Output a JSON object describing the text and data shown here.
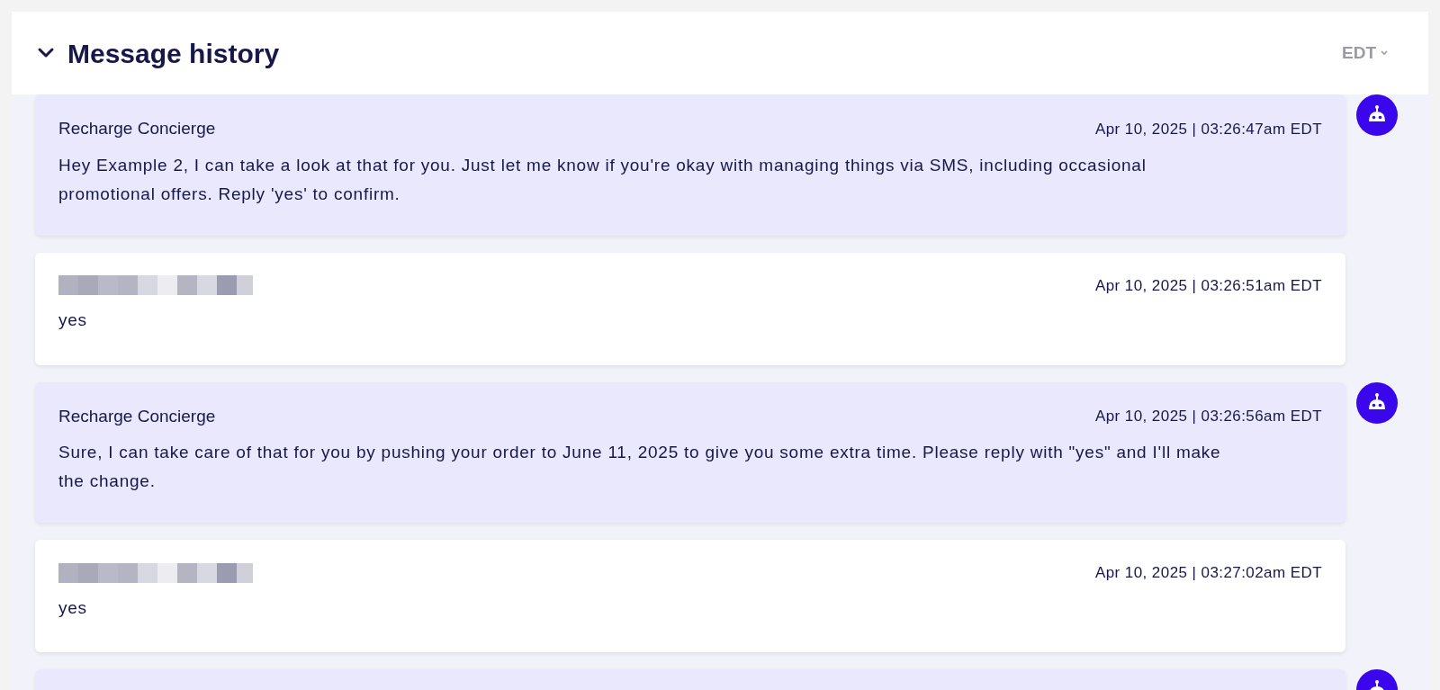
{
  "header": {
    "title": "Message history",
    "expanded": true,
    "timezone": "EDT"
  },
  "messages": [
    {
      "kind": "bot",
      "sender": "Recharge Concierge",
      "time": "Apr 10, 2025 | 03:26:47am EDT",
      "text": "Hey Example 2, I can take a look at that for you. Just let me know if you're okay with managing things via SMS, including occasional promotional offers. Reply 'yes' to confirm."
    },
    {
      "kind": "customer",
      "time": "Apr 10, 2025 | 03:26:51am EDT",
      "text": "yes"
    },
    {
      "kind": "bot",
      "sender": "Recharge Concierge",
      "time": "Apr 10, 2025 | 03:26:56am EDT",
      "text": "Sure, I can take care of that for you by pushing your order to June 11, 2025 to give you some extra time. Please reply with \"yes\" and I'll make the change."
    },
    {
      "kind": "customer",
      "time": "Apr 10, 2025 | 03:27:02am EDT",
      "text": "yes"
    },
    {
      "kind": "bot"
    }
  ]
}
